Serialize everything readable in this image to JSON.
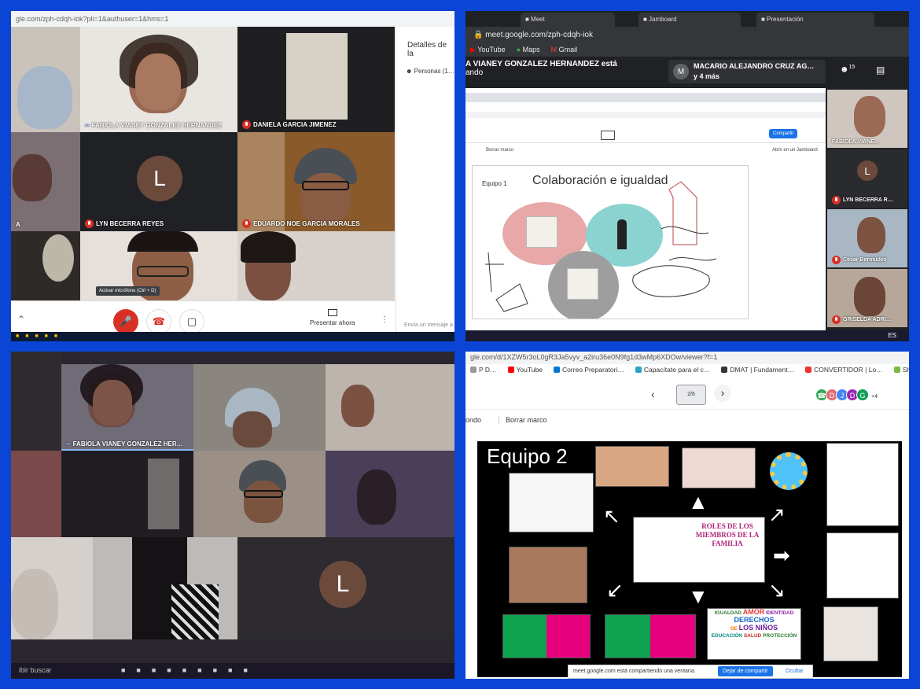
{
  "panel1": {
    "url": "gle.com/zph-cdqh-iok?pli=1&authuser=1&hms=1",
    "side_title": "Detalles de la",
    "side_people": "Personas (1…",
    "side_msg": "Envía un mensaje a",
    "tooltip": "Activar micrófono (Ctrl + D)",
    "present_label": "Presentar ahora",
    "participants": [
      {
        "name": "FABIOLA VIANEY GONZALEZ HERNANDEZ"
      },
      {
        "name": "DANIELA GARCIA JIMENEZ"
      },
      {
        "name": "A"
      },
      {
        "name": "LYN BECERRA REYES",
        "initial": "L"
      },
      {
        "name": "EDUARDO NOE GARCIA MORALES"
      }
    ]
  },
  "panel2": {
    "address": "meet.google.com/zph-cdqh-iok",
    "bookmarks": [
      "YouTube",
      "Maps",
      "Gmail"
    ],
    "presenting_text": "A VIANEY GONZALEZ HERNANDEZ está",
    "presenting_text2": "ando",
    "notif_initial": "M",
    "notif_line1": "MACARIO ALEJANDRO CRUZ AG…",
    "notif_line2": "y 4 más",
    "people_count": "15",
    "slide_label": "Equipo 1",
    "slide_title": "Colaboración e igualdad",
    "share_btn": "Compartir",
    "inner_menu1": "Borrar marco",
    "inner_menu2": "Abrir en un Jamboard",
    "side_tiles": [
      {
        "name": "FABIOLA VIANE…"
      },
      {
        "name": "LYN BECERRA R…",
        "initial": "L"
      },
      {
        "name": "Cesar Bermudez"
      },
      {
        "name": "GRISELDA ADRI…"
      }
    ],
    "lang": "ES"
  },
  "panel3": {
    "participant_name": "FABIOLA VIANEY GONZALEZ HER…",
    "avatar_initial": "L",
    "search_text": "ibir buscar"
  },
  "panel4": {
    "url": "gle.com/d/1XZW5r3oL0gR3Ja5vyv_a2iru36e0N9fg1d3wMp6XDOw/viewer?f=1",
    "bookmarks": [
      "P D…",
      "YouTube",
      "Correo Preparatori…",
      "Capacítate para el c…",
      "DMAT | Fundament…",
      "CONVERTIDOR | Lo…",
      "Shinukalek Tutorial I…"
    ],
    "page": "2/6",
    "menu1": "ondo",
    "menu2": "Borrar marco",
    "chips": [
      "D",
      "J",
      "D",
      "G"
    ],
    "chips_more": "+4",
    "slide_title": "Equipo 2",
    "center_title": "ROLES DE LOS MIEMBROS DE LA FAMILIA",
    "values_words": [
      "IGUALDAD",
      "AMOR",
      "IDENTIDAD",
      "DERECHOS",
      "DE",
      "LOS NIÑOS",
      "EDUCACIÓN",
      "SALUD",
      "PROTECCIÓN"
    ],
    "share_notice": "meet.google.com está compartiendo una ventana.",
    "stop_btn": "Dejar de compartir",
    "hide_btn": "Ocultar"
  },
  "colors": {
    "frame": "#0a45d6",
    "meet_dark": "#202124",
    "mic_off": "#d93025",
    "share_blue": "#1a73e8",
    "slide_black": "#000000"
  }
}
